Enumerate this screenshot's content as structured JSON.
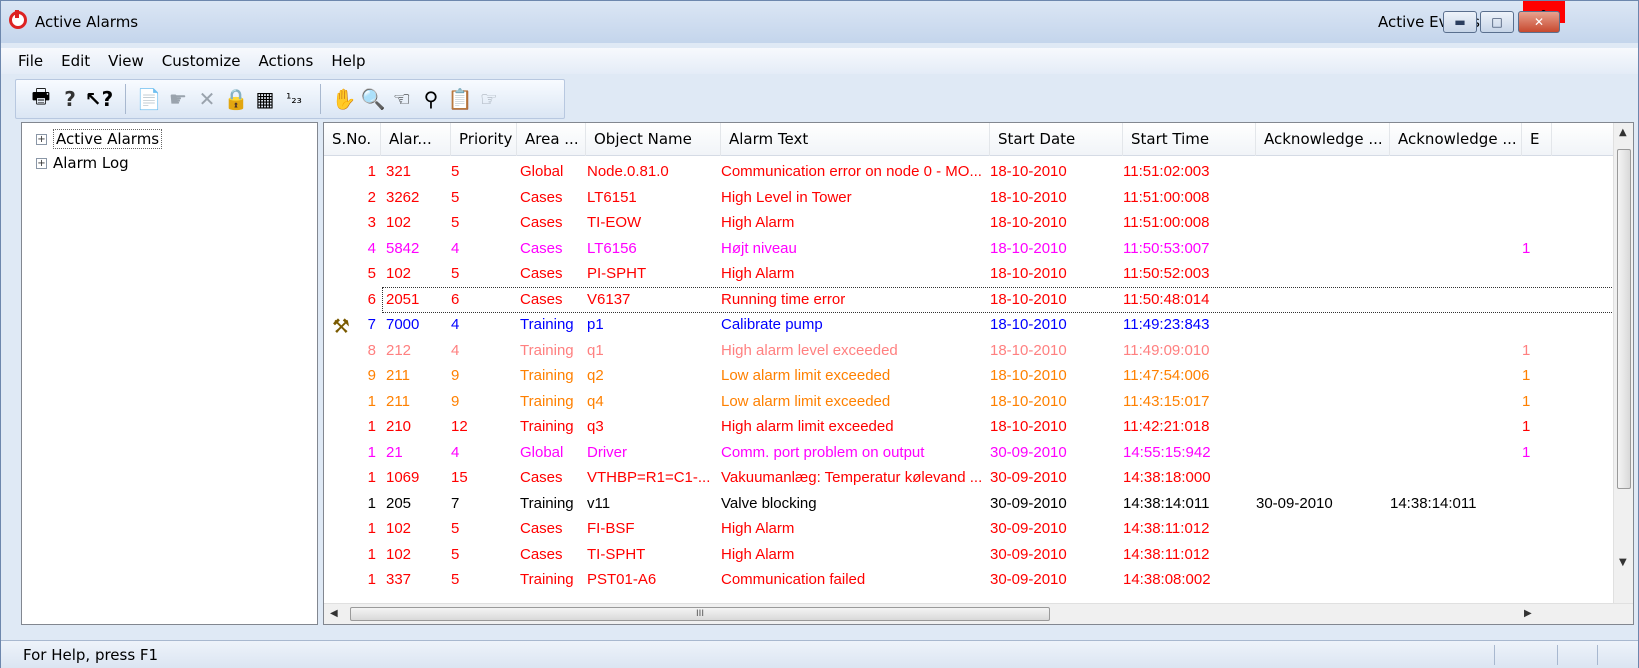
{
  "window": {
    "title": "Active Alarms",
    "right_title": "Active Events"
  },
  "menu": [
    "File",
    "Edit",
    "View",
    "Customize",
    "Actions",
    "Help"
  ],
  "toolbar_icons": [
    "print-icon",
    "help-icon",
    "context-help-icon",
    "properties-icon",
    "acknowledge-icon",
    "delete-icon",
    "lock-icon",
    "notes-icon",
    "numbering-icon",
    "handshake-icon",
    "find-icon",
    "filter-icon",
    "zoom-icon",
    "clipboard-icon",
    "hand-icon"
  ],
  "tree": [
    {
      "label": "Active Alarms",
      "selected": true
    },
    {
      "label": "Alarm Log",
      "selected": false
    }
  ],
  "columns": [
    "S.No.",
    "Alar...",
    "Priority",
    "Area ...",
    "Object Name",
    "Alarm Text",
    "Start Date",
    "Start Time",
    "Acknowledge ...",
    "Acknowledge ...",
    "E"
  ],
  "colors": {
    "red": "#ff0000",
    "magenta": "#ff00ff",
    "blue": "#0000ff",
    "pink": "#ff8080",
    "orange": "#ff8000",
    "black": "#000000"
  },
  "rows": [
    {
      "sno": "1",
      "alarm": "321",
      "priority": "5",
      "area": "Global",
      "object": "Node.0.81.0",
      "text": "Communication error on node 0 - MO...",
      "start_date": "18-10-2010",
      "start_time": "11:51:02:003",
      "ack_date": "",
      "ack_time": "",
      "extra": "",
      "color": "red"
    },
    {
      "sno": "2",
      "alarm": "3262",
      "priority": "5",
      "area": "Cases",
      "object": "LT6151",
      "text": "High Level in Tower",
      "start_date": "18-10-2010",
      "start_time": "11:51:00:008",
      "ack_date": "",
      "ack_time": "",
      "extra": "",
      "color": "red"
    },
    {
      "sno": "3",
      "alarm": "102",
      "priority": "5",
      "area": "Cases",
      "object": "TI-EOW",
      "text": "High Alarm",
      "start_date": "18-10-2010",
      "start_time": "11:51:00:008",
      "ack_date": "",
      "ack_time": "",
      "extra": "",
      "color": "red"
    },
    {
      "sno": "4",
      "alarm": "5842",
      "priority": "4",
      "area": "Cases",
      "object": "LT6156",
      "text": "Højt niveau",
      "start_date": "18-10-2010",
      "start_time": "11:50:53:007",
      "ack_date": "",
      "ack_time": "",
      "extra": "1",
      "color": "magenta"
    },
    {
      "sno": "5",
      "alarm": "102",
      "priority": "5",
      "area": "Cases",
      "object": "PI-SPHT",
      "text": "High Alarm",
      "start_date": "18-10-2010",
      "start_time": "11:50:52:003",
      "ack_date": "",
      "ack_time": "",
      "extra": "",
      "color": "red"
    },
    {
      "sno": "6",
      "alarm": "2051",
      "priority": "6",
      "area": "Cases",
      "object": "V6137",
      "text": "Running time error",
      "start_date": "18-10-2010",
      "start_time": "11:50:48:014",
      "ack_date": "",
      "ack_time": "",
      "extra": "",
      "color": "red",
      "focus": true
    },
    {
      "sno": "7",
      "alarm": "7000",
      "priority": "4",
      "area": "Training",
      "object": "p1",
      "text": "Calibrate pump",
      "start_date": "18-10-2010",
      "start_time": "11:49:23:843",
      "ack_date": "",
      "ack_time": "",
      "extra": "",
      "color": "blue",
      "icon": "tools-icon"
    },
    {
      "sno": "8",
      "alarm": "212",
      "priority": "4",
      "area": "Training",
      "object": "q1",
      "text": "High alarm level exceeded",
      "start_date": "18-10-2010",
      "start_time": "11:49:09:010",
      "ack_date": "",
      "ack_time": "",
      "extra": "1",
      "color": "pink"
    },
    {
      "sno": "9",
      "alarm": "211",
      "priority": "9",
      "area": "Training",
      "object": "q2",
      "text": "Low alarm limit exceeded",
      "start_date": "18-10-2010",
      "start_time": "11:47:54:006",
      "ack_date": "",
      "ack_time": "",
      "extra": "1",
      "color": "orange"
    },
    {
      "sno": "1",
      "alarm": "211",
      "priority": "9",
      "area": "Training",
      "object": "q4",
      "text": "Low alarm limit exceeded",
      "start_date": "18-10-2010",
      "start_time": "11:43:15:017",
      "ack_date": "",
      "ack_time": "",
      "extra": "1",
      "color": "orange"
    },
    {
      "sno": "1",
      "alarm": "210",
      "priority": "12",
      "area": "Training",
      "object": "q3",
      "text": "High alarm limit exceeded",
      "start_date": "18-10-2010",
      "start_time": "11:42:21:018",
      "ack_date": "",
      "ack_time": "",
      "extra": "1",
      "color": "red"
    },
    {
      "sno": "1",
      "alarm": "21",
      "priority": "4",
      "area": "Global",
      "object": "Driver",
      "text": "Comm. port problem on output",
      "start_date": "30-09-2010",
      "start_time": "14:55:15:942",
      "ack_date": "",
      "ack_time": "",
      "extra": "1",
      "color": "magenta"
    },
    {
      "sno": "1",
      "alarm": "1069",
      "priority": "15",
      "area": "Cases",
      "object": "VTHBP=R1=C1-...",
      "text": "Vakuumanlæg: Temperatur kølevand ...",
      "start_date": "30-09-2010",
      "start_time": "14:38:18:000",
      "ack_date": "",
      "ack_time": "",
      "extra": "",
      "color": "red"
    },
    {
      "sno": "1",
      "alarm": "205",
      "priority": "7",
      "area": "Training",
      "object": "v11",
      "text": "Valve blocking",
      "start_date": "30-09-2010",
      "start_time": "14:38:14:011",
      "ack_date": "30-09-2010",
      "ack_time": "14:38:14:011",
      "extra": "",
      "color": "black"
    },
    {
      "sno": "1",
      "alarm": "102",
      "priority": "5",
      "area": "Cases",
      "object": "FI-BSF",
      "text": "High Alarm",
      "start_date": "30-09-2010",
      "start_time": "14:38:11:012",
      "ack_date": "",
      "ack_time": "",
      "extra": "",
      "color": "red"
    },
    {
      "sno": "1",
      "alarm": "102",
      "priority": "5",
      "area": "Cases",
      "object": "TI-SPHT",
      "text": "High Alarm",
      "start_date": "30-09-2010",
      "start_time": "14:38:11:012",
      "ack_date": "",
      "ack_time": "",
      "extra": "",
      "color": "red"
    },
    {
      "sno": "1",
      "alarm": "337",
      "priority": "5",
      "area": "Training",
      "object": "PST01-A6",
      "text": "Communication failed",
      "start_date": "30-09-2010",
      "start_time": "14:38:08:002",
      "ack_date": "",
      "ack_time": "",
      "extra": "",
      "color": "red"
    }
  ],
  "status": {
    "text": "For Help, press F1"
  }
}
